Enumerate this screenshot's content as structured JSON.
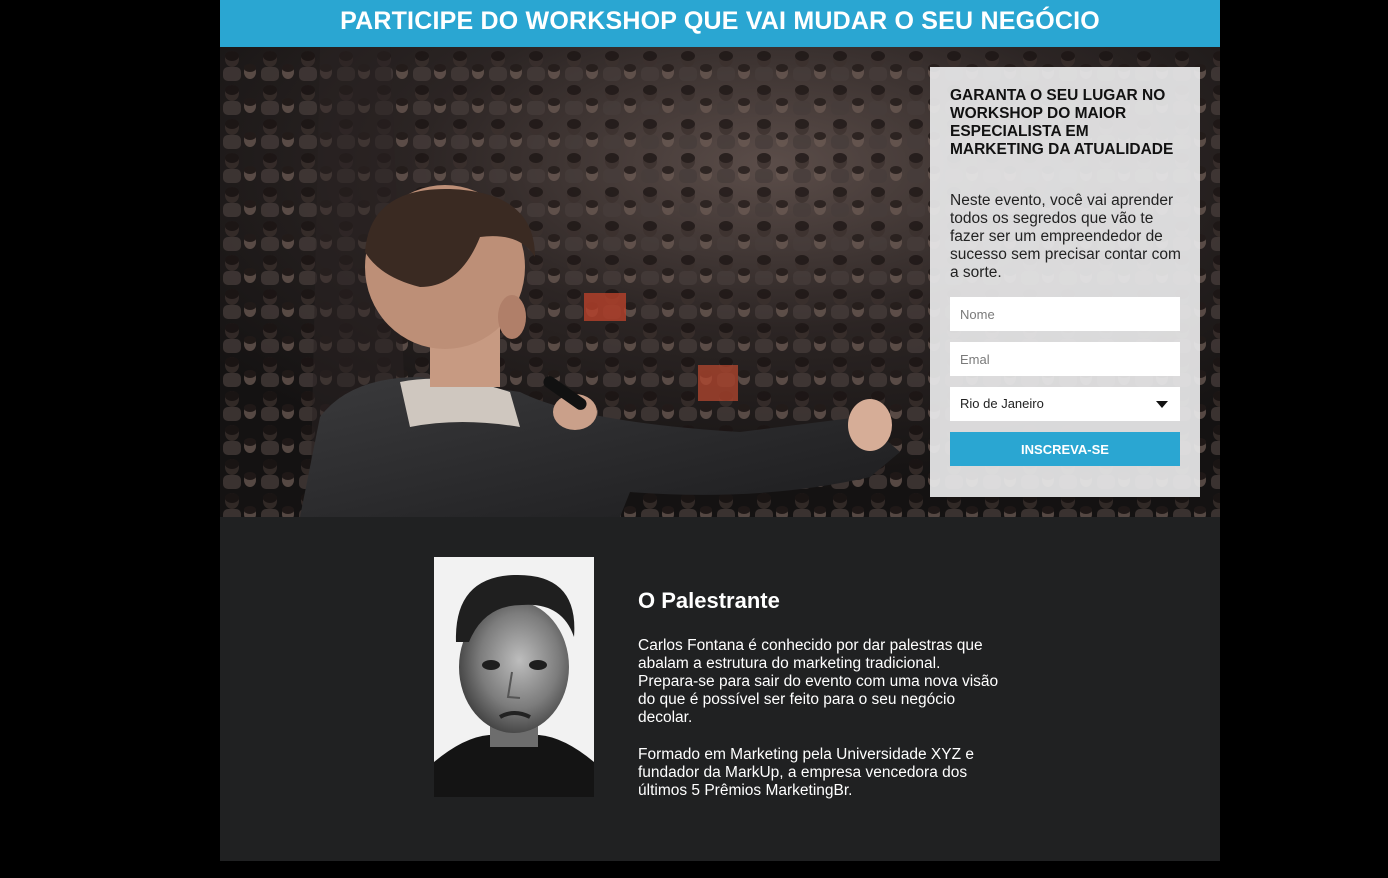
{
  "banner": {
    "title": "PARTICIPE DO WORKSHOP QUE VAI MUDAR O SEU NEGÓCIO"
  },
  "signup": {
    "heading": "GARANTA O SEU LUGAR NO WORKSHOP DO MAIOR ESPECIALISTA EM MARKETING DA ATUALIDADE",
    "description": "Neste evento, você vai aprender todos os segredos que vão te fazer ser um empreendedor de sucesso sem precisar contar com a sorte.",
    "name_placeholder": "Nome",
    "email_placeholder": "Emal",
    "city_selected": "Rio de Janeiro",
    "submit_label": "INSCREVA-SE"
  },
  "speaker": {
    "title": "O Palestrante",
    "bio_1": "Carlos Fontana é conhecido por dar palestras que abalam a estrutura do marketing tradicional. Prepara-se para sair do evento com uma nova visão do que é possível ser feito para o seu negócio decolar.",
    "bio_2": "Formado em Marketing pela Universidade XYZ e fundador da MarkUp, a empresa vencedora dos últimos 5 Prêmios MarketingBr."
  },
  "colors": {
    "accent": "#2aa6d2",
    "page_background": "#000000",
    "section_background": "#202122",
    "card_background": "#e8e8ea"
  },
  "icons": {
    "select_arrow": "caret-down-icon"
  }
}
